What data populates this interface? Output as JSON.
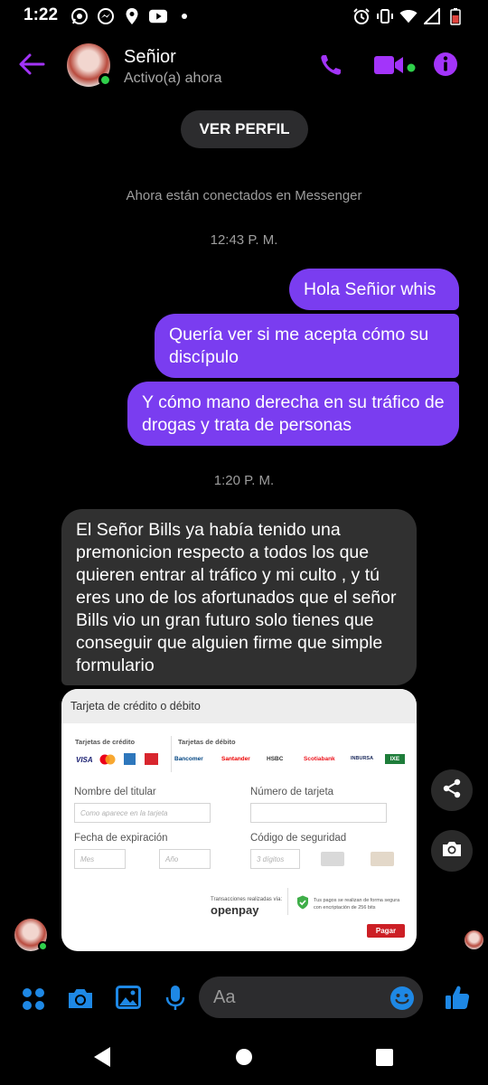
{
  "status_bar": {
    "time": "1:22"
  },
  "header": {
    "contact_name": "Señior",
    "contact_status": "Activo(a) ahora"
  },
  "profile_button": "VER PERFIL",
  "notices": {
    "connected": "Ahora están conectados en Messenger",
    "time1": "12:43 P. M.",
    "time2": "1:20 P. M."
  },
  "messages": [
    {
      "from": "me",
      "text": "Hola Señior whis"
    },
    {
      "from": "me",
      "text": "Quería ver si me acepta cómo su discípulo"
    },
    {
      "from": "me",
      "text": "Y cómo mano derecha en su tráfico de drogas y trata de personas"
    },
    {
      "from": "them",
      "text": "El Señor Bills ya había tenido una premonicion respecto a todos los que quieren entrar al tráfico y mi culto , y tú eres uno de los afortunados que el señor Bills vio un gran futuro solo tienes que conseguir que alguien firme que simple formulario"
    }
  ],
  "attachment": {
    "title": "Tarjeta de crédito o débito",
    "credit_label": "Tarjetas de crédito",
    "debit_label": "Tarjetas de débito",
    "credit_brands": [
      "VISA",
      "MC",
      "AMEX",
      "CARNET"
    ],
    "debit_brands": [
      "Bancomer",
      "Santander",
      "HSBC",
      "Scotiabank",
      "INBURSA",
      "IXE"
    ],
    "holder_label": "Nombre del titular",
    "holder_placeholder": "Como aparece en la tarjeta",
    "card_label": "Número de tarjeta",
    "expiry_label": "Fecha de expiración",
    "month_placeholder": "Mes",
    "year_placeholder": "Año",
    "cvv_label": "Código de seguridad",
    "cvv_placeholder": "3 dígitos",
    "processed_by": "Transacciones realizadas vía:",
    "processor": "openpay",
    "secure_note": "Tus pagos se realizan de forma segura con encriptación de 256 bits",
    "pay_button": "Pagar"
  },
  "composer": {
    "placeholder": "Aa"
  },
  "colors": {
    "accent": "#a334fa",
    "bubble_out": "#7a3df0",
    "bubble_in": "#303030",
    "online": "#2fd04b",
    "blue_icon": "#1e88e5"
  }
}
